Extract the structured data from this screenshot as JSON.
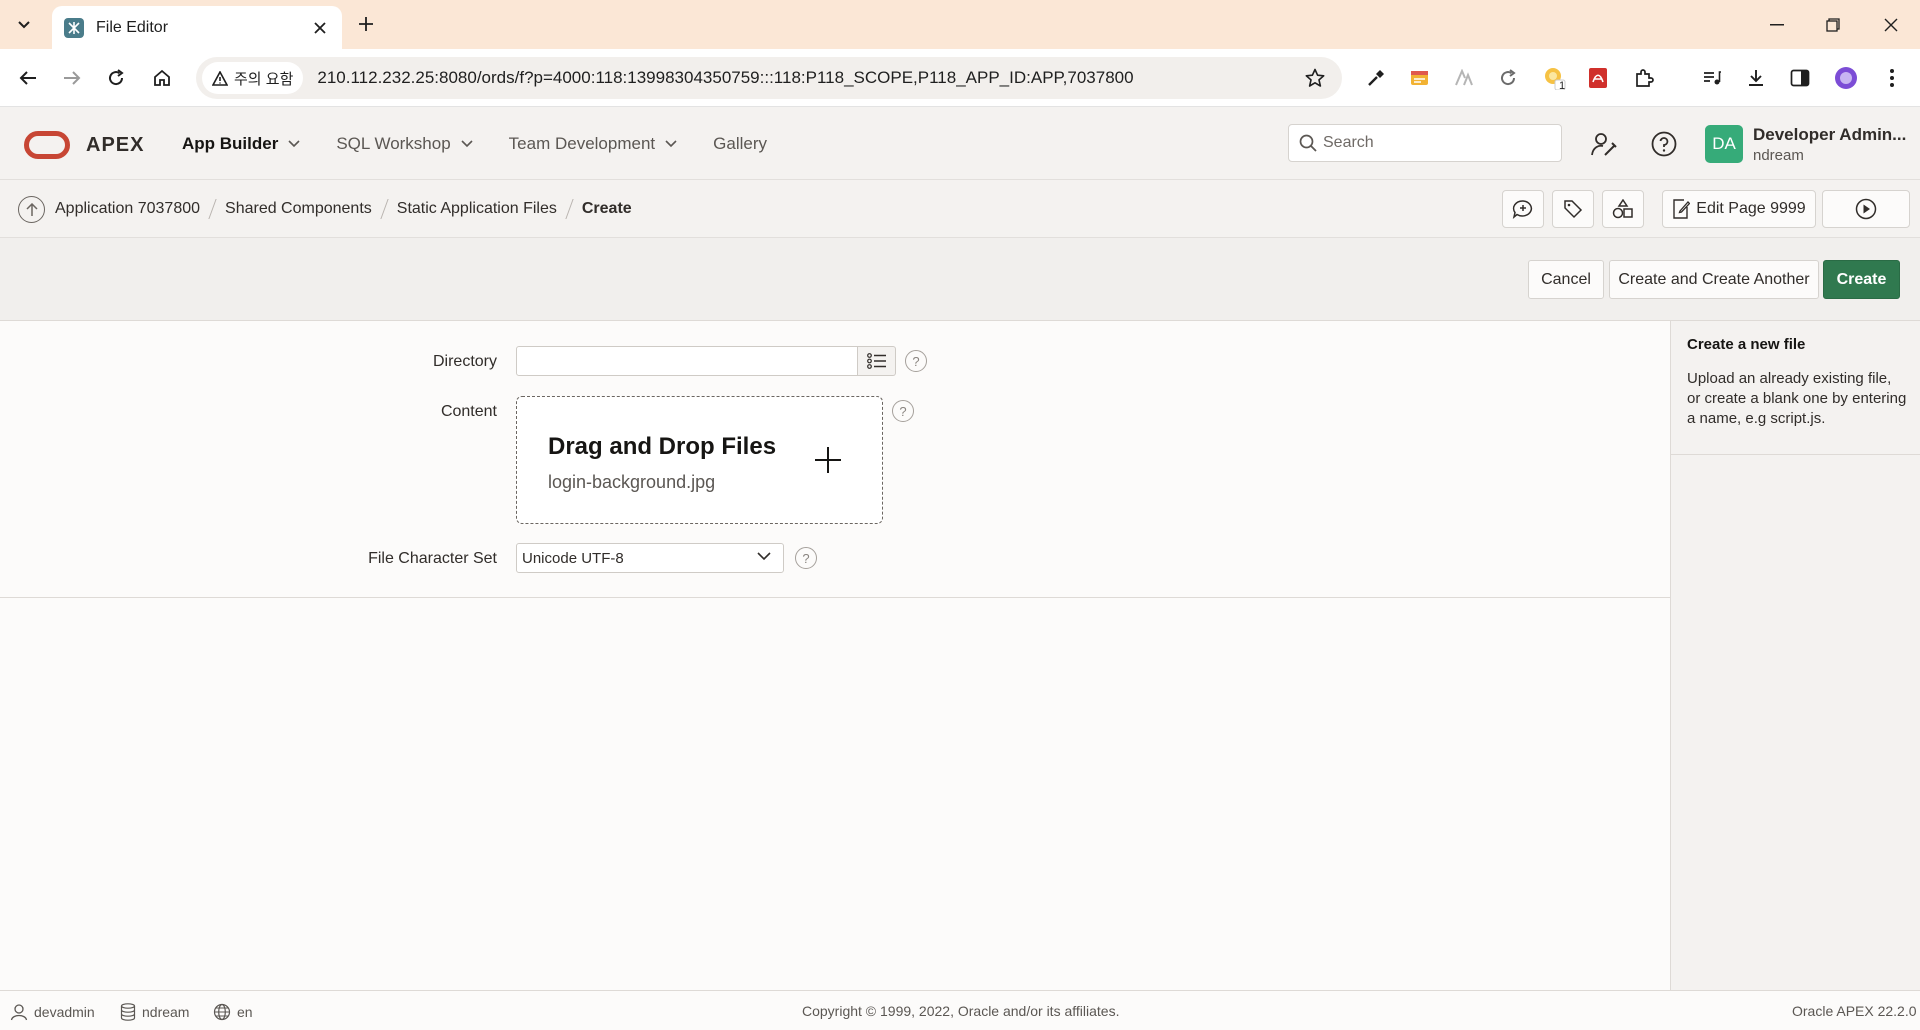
{
  "browser": {
    "tab_title": "File Editor",
    "security_label": "주의 요함",
    "url": "210.112.232.25:8080/ords/f?p=4000:118:13998304350759:::118:P118_SCOPE,P118_APP_ID:APP,7037800",
    "extension_badge": "1"
  },
  "header": {
    "product": "APEX",
    "nav": [
      {
        "label": "App Builder"
      },
      {
        "label": "SQL Workshop"
      },
      {
        "label": "Team Development"
      },
      {
        "label": "Gallery"
      }
    ],
    "search_placeholder": "Search",
    "user_initials": "DA",
    "user_name": "Developer Admin...",
    "workspace": "ndream"
  },
  "breadcrumb": {
    "items": [
      "Application 7037800",
      "Shared Components",
      "Static Application Files",
      "Create"
    ],
    "edit_page_label": "Edit Page 9999"
  },
  "buttons": {
    "cancel": "Cancel",
    "create_another": "Create and Create Another",
    "create": "Create"
  },
  "form": {
    "directory_label": "Directory",
    "directory_value": "",
    "content_label": "Content",
    "dropzone_title": "Drag and Drop Files",
    "dropzone_file": "login-background.jpg",
    "charset_label": "File Character Set",
    "charset_value": "Unicode UTF-8",
    "help_glyph": "?"
  },
  "help_panel": {
    "title": "Create a new file",
    "body": "Upload an already existing file, or create a blank one by entering a name, e.g script.js."
  },
  "footer": {
    "user": "devadmin",
    "workspace": "ndream",
    "language": "en",
    "copyright": "Copyright © 1999, 2022, Oracle and/or its affiliates.",
    "version": "Oracle APEX 22.2.0"
  },
  "colors": {
    "accent_primary": "#30794f",
    "oracle_red": "#c74634",
    "avatar_bg": "#36ab79",
    "tabbar_bg": "#fbe7d6"
  }
}
